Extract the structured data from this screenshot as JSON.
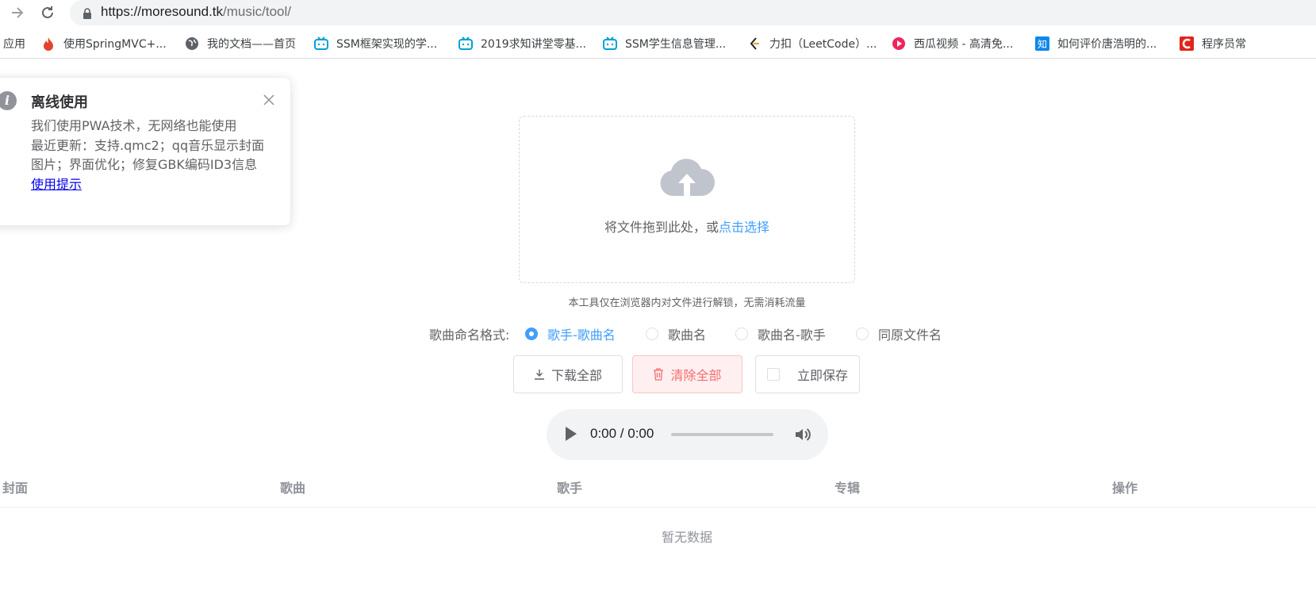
{
  "browser": {
    "url_host": "https://moresound.tk",
    "url_path": "/music/tool/",
    "bookmarks": [
      {
        "label": "应用",
        "icon": "apps-icon"
      },
      {
        "label": "使用SpringMVC+...",
        "icon": "flame-icon"
      },
      {
        "label": "我的文档——首页",
        "icon": "globe-icon"
      },
      {
        "label": "SSM框架实现的学...",
        "icon": "bilibili-icon"
      },
      {
        "label": "2019求知讲堂零基...",
        "icon": "bilibili-icon"
      },
      {
        "label": "SSM学生信息管理...",
        "icon": "bilibili-icon"
      },
      {
        "label": "力扣（LeetCode）...",
        "icon": "leetcode-icon"
      },
      {
        "label": "西瓜视频 - 高清免...",
        "icon": "xigua-icon"
      },
      {
        "label": "如何评价唐浩明的...",
        "icon": "zhihu-icon"
      },
      {
        "label": "程序员常",
        "icon": "csdn-icon"
      }
    ]
  },
  "notification": {
    "title": "离线使用",
    "line1": "我们使用PWA技术，无网络也能使用",
    "line2": "最近更新：支持.qmc2；qq音乐显示封面图片；界面优化；修复GBK编码ID3信息",
    "link": "使用提示"
  },
  "upload": {
    "text": "将文件拖到此处，或",
    "link": "点击选择",
    "tip": "本工具仅在浏览器内对文件进行解锁，无需消耗流量"
  },
  "naming": {
    "label": "歌曲命名格式:",
    "options": [
      "歌手-歌曲名",
      "歌曲名",
      "歌曲名-歌手",
      "同原文件名"
    ],
    "selected": "歌手-歌曲名"
  },
  "actions": {
    "download_all": "下载全部",
    "clear_all": "清除全部",
    "save_now": "立即保存"
  },
  "player": {
    "time": "0:00 / 0:00"
  },
  "table": {
    "columns": [
      "封面",
      "歌曲",
      "歌手",
      "专辑",
      "操作"
    ],
    "empty": "暂无数据"
  },
  "colors": {
    "primary": "#409eff",
    "danger": "#f56c6c",
    "text": "#606266",
    "muted": "#909399"
  }
}
